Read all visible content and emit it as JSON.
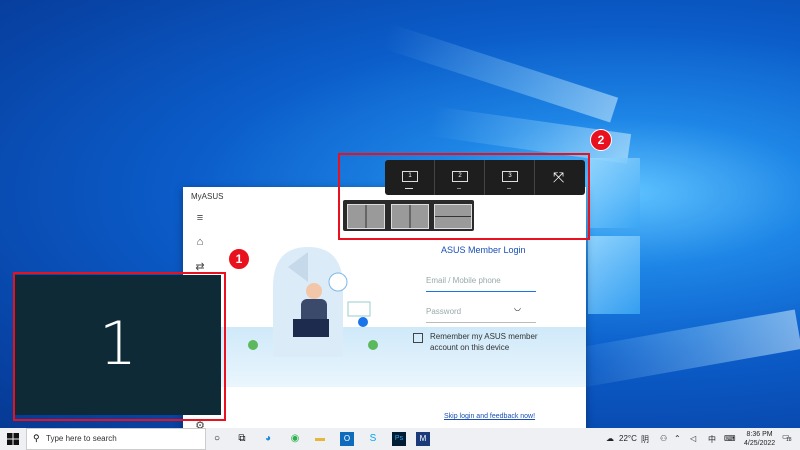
{
  "app": {
    "title": "MyASUS",
    "login_title": "ASUS Member Login",
    "email_placeholder": "Email / Mobile phone",
    "password_placeholder": "Password",
    "remember_label": "Remember my ASUS member account on this device",
    "skip_link": "Skip login and feedback now!"
  },
  "snap": {
    "monitors": [
      "1",
      "2",
      "3"
    ],
    "expand_icon": "expand-icon"
  },
  "identifier": {
    "number": "1"
  },
  "badges": {
    "one": "1",
    "two": "2"
  },
  "taskbar": {
    "search_placeholder": "Type here to search",
    "weather": "22°C",
    "weather_desc": "阴",
    "ime": "中",
    "time": "8:36 PM",
    "date": "4/25/2022",
    "notif_count": "18"
  },
  "colors": {
    "highlight": "#e8111d",
    "link": "#1a4fb5",
    "accent": "#1a73e8"
  }
}
